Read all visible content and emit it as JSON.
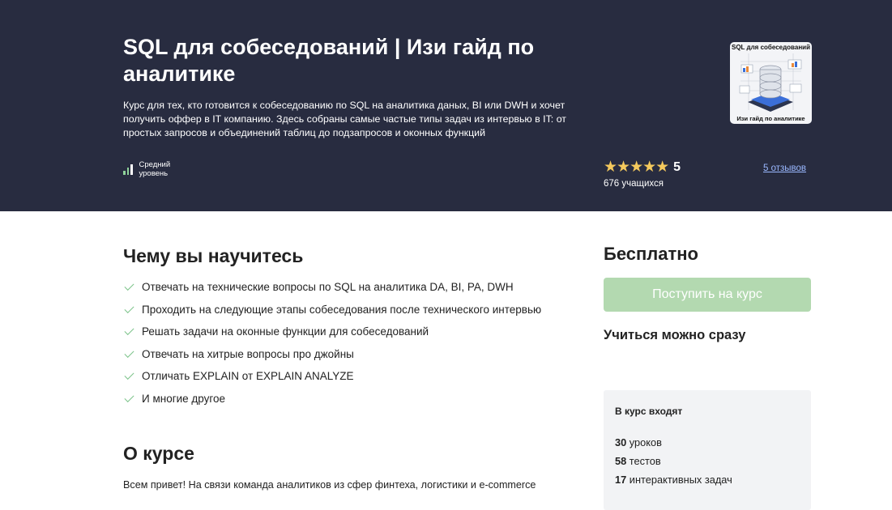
{
  "course": {
    "title": "SQL для собеседований | Изи гайд по аналитике",
    "description": "Курс для тех, кто готовится к собеседованию по SQL на аналитика даных, BI или DWH и хочет получить оффер в IT компанию. Здесь собраны самые частые типы задач из интервью в IT: от простых запросов и объединений таблиц до подзапросов и оконных функций",
    "level": "Средний уровень",
    "rating": {
      "stars": "★★★★★",
      "value": "5",
      "learners": "676 учащихся",
      "reviews_link": "5 отзывов"
    },
    "thumbnail": {
      "top_text": "SQL для собеседований",
      "bottom_text": "Изи гайд по аналитике"
    }
  },
  "learn": {
    "title": "Чему вы научитесь",
    "items": [
      "Отвечать на технические вопросы по SQL на аналитика DA, BI, PA, DWH",
      "Проходить на следующие этапы собеседования после технического интервью",
      "Решать задачи на оконные функции для собеседований",
      "Отвечать на хитрые вопросы про джойны",
      "Отличать EXPLAIN от EXPLAIN ANALYZE",
      "И многие другое"
    ]
  },
  "about": {
    "title": "О курсе",
    "text": "Всем привет! На связи команда аналитиков из сфер финтеха, логистики и e-commerce"
  },
  "sidebar": {
    "price": "Бесплатно",
    "enroll_label": "Поступить на курс",
    "study_now": "Учиться можно сразу",
    "includes_title": "В курс входят",
    "includes": [
      {
        "count": "30",
        "label": "уроков"
      },
      {
        "count": "58",
        "label": "тестов"
      },
      {
        "count": "17",
        "label": "интерактивных задач"
      }
    ]
  },
  "colors": {
    "hero_bg": "#282c40",
    "accent_green": "#7cc38a",
    "button_disabled": "#b3d9b0",
    "star": "#f4c95d",
    "link": "#9ab8ff"
  }
}
